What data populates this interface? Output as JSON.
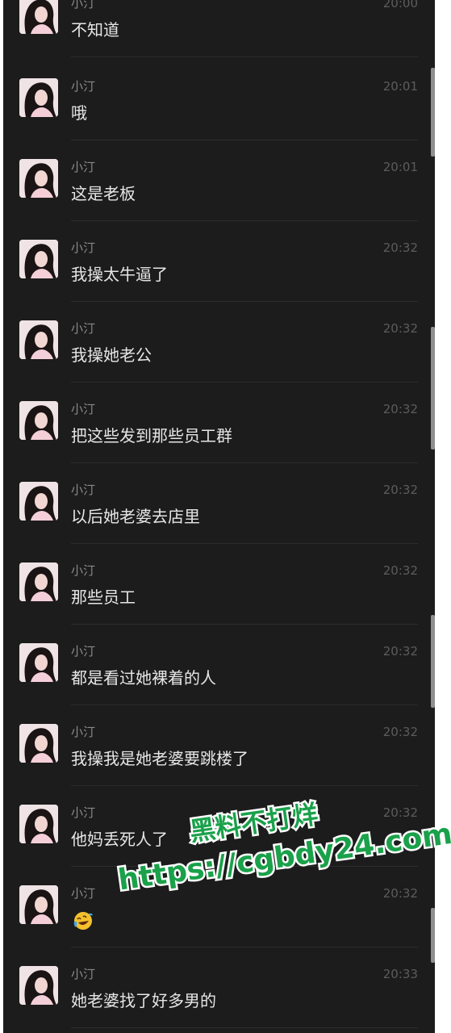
{
  "chat": {
    "messages": [
      {
        "sender": "小汀",
        "time": "20:00",
        "text": "不知道"
      },
      {
        "sender": "小汀",
        "time": "20:01",
        "text": "哦"
      },
      {
        "sender": "小汀",
        "time": "20:01",
        "text": "这是老板"
      },
      {
        "sender": "小汀",
        "time": "20:32",
        "text": "我操太牛逼了"
      },
      {
        "sender": "小汀",
        "time": "20:32",
        "text": "我操她老公"
      },
      {
        "sender": "小汀",
        "time": "20:32",
        "text": "把这些发到那些员工群"
      },
      {
        "sender": "小汀",
        "time": "20:32",
        "text": "以后她老婆去店里"
      },
      {
        "sender": "小汀",
        "time": "20:32",
        "text": "那些员工"
      },
      {
        "sender": "小汀",
        "time": "20:32",
        "text": "都是看过她裸着的人"
      },
      {
        "sender": "小汀",
        "time": "20:32",
        "text": "我操我是她老婆要跳楼了"
      },
      {
        "sender": "小汀",
        "time": "20:32",
        "text": "他妈丢死人了"
      },
      {
        "sender": "小汀",
        "time": "20:32",
        "emoji": "laughing-crying-emoji"
      },
      {
        "sender": "小汀",
        "time": "20:33",
        "text": "她老婆找了好多男的"
      }
    ]
  },
  "watermark": {
    "line1": "黑料不打烊",
    "line2": "https://cgbdy24.com",
    "color": "#1aa14a"
  },
  "colors": {
    "background": "#1c1c1c",
    "message_text": "#e6e6e6",
    "sender_text": "#8a8a8a",
    "time_text": "#5c5c5c"
  }
}
